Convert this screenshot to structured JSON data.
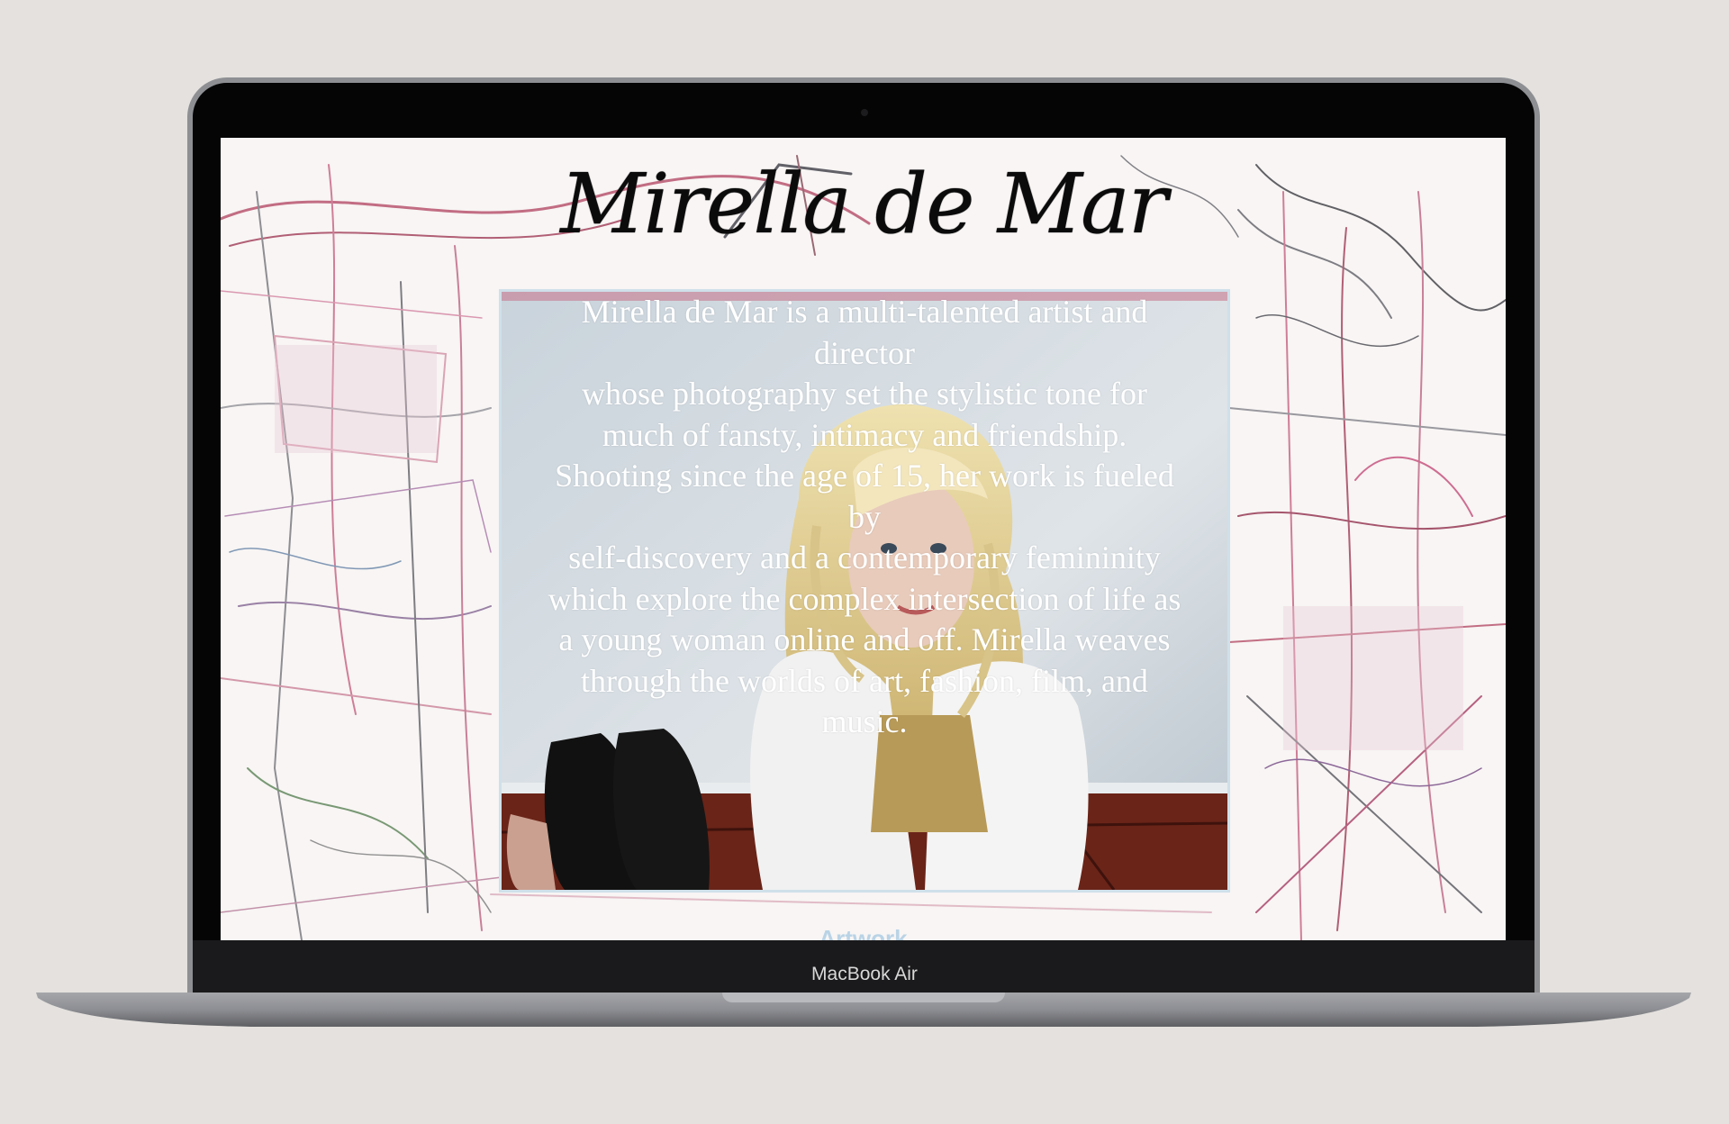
{
  "device": {
    "model_label": "MacBook Air"
  },
  "site": {
    "title": "Mirella de Mar",
    "bio": "Mirella de Mar is a multi-talented artist and\ndirector\nwhose photography set the stylistic tone for\nmuch of fansty, intimacy and friendship.\nShooting since the age of 15, her work is fueled\nby\nself-discovery and  a contemporary femininity\nwhich explore the complex intersection of life as\na young woman online and off. Mirella weaves\nthrough the worlds of art, fashion, film, and\nmusic.",
    "nav_link": "Artwork"
  },
  "colors": {
    "page_background": "#e4e1de",
    "bezel": "#050505",
    "title_text": "#0b0b0b",
    "bio_text": "#ffffff",
    "nav_link": "#b9d3e6",
    "card_border": "#cfe0ea"
  }
}
